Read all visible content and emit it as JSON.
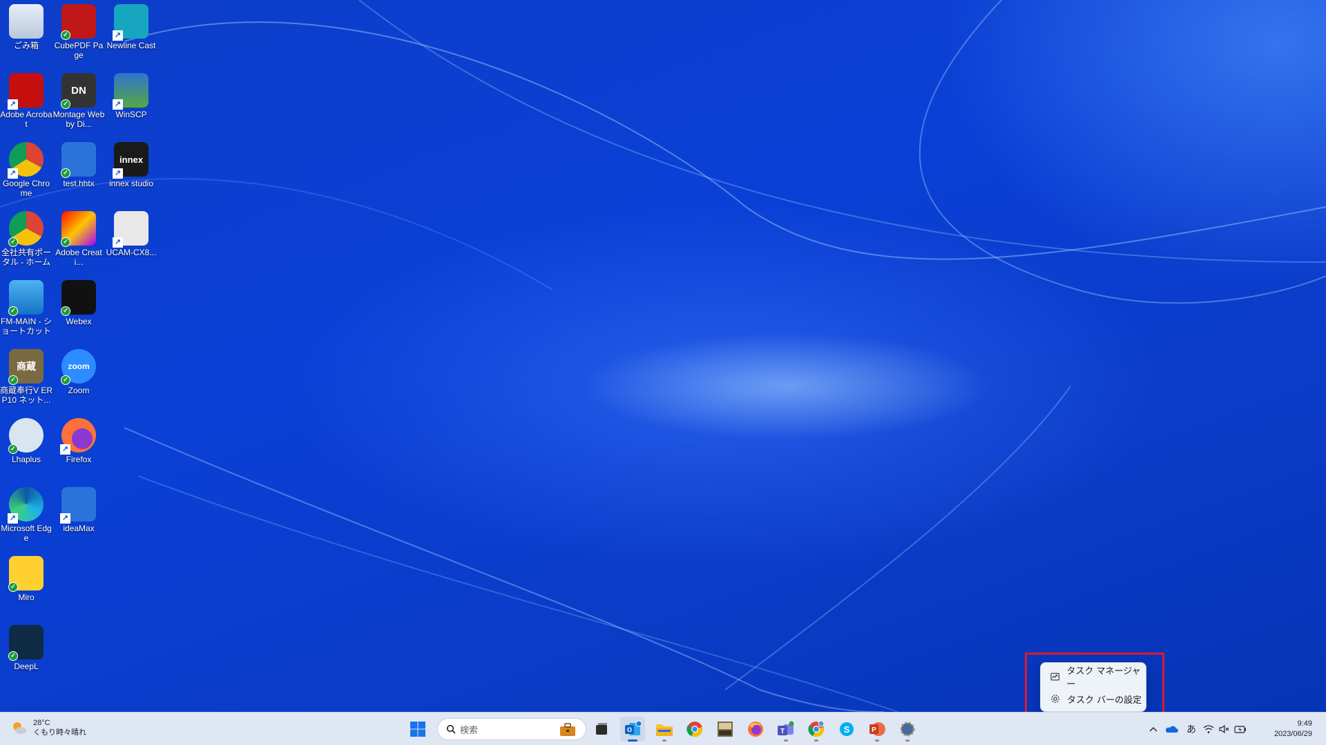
{
  "desktop": {
    "icons": [
      {
        "label": "ごみ箱",
        "icon": "recycle-bin-icon"
      },
      {
        "label": "CubePDF Page",
        "icon": "cubepdf-icon"
      },
      {
        "label": "Newline Cast",
        "icon": "newline-cast-icon"
      },
      {
        "label": "Adobe Acrobat",
        "icon": "acrobat-icon"
      },
      {
        "label": "Montage Web by Di...",
        "icon": "montage-icon",
        "text": "DN"
      },
      {
        "label": "WinSCP",
        "icon": "winscp-icon"
      },
      {
        "label": "Google Chrome",
        "icon": "chrome-icon"
      },
      {
        "label": "test.hhtx",
        "icon": "ideamax-file-icon"
      },
      {
        "label": "innex studio",
        "icon": "innex-studio-icon",
        "text": "innex"
      },
      {
        "label": "全社共有ポータル - ホーム",
        "icon": "chrome-portal-icon"
      },
      {
        "label": "Adobe Creati...",
        "icon": "creative-cloud-icon"
      },
      {
        "label": "UCAM-CX8...",
        "icon": "camera-icon"
      },
      {
        "label": "FM-MAIN - ショートカット",
        "icon": "monitor-icon"
      },
      {
        "label": "Webex",
        "icon": "webex-icon"
      },
      {
        "label": "商蔵奉行V ERP10 ネット...",
        "icon": "shozo-bugyo-icon",
        "text": "商蔵"
      },
      {
        "label": "Zoom",
        "icon": "zoom-icon",
        "text": "zoom"
      },
      {
        "label": "Lhaplus",
        "icon": "lhaplus-icon"
      },
      {
        "label": "Firefox",
        "icon": "firefox-icon"
      },
      {
        "label": "Microsoft Edge",
        "icon": "edge-icon"
      },
      {
        "label": "ideaMax",
        "icon": "ideamax-icon"
      },
      {
        "label": "Miro",
        "icon": "miro-icon"
      },
      {
        "label": "DeepL",
        "icon": "deepl-icon"
      }
    ]
  },
  "taskbar": {
    "weather": {
      "temp": "28°C",
      "desc": "くもり時々晴れ"
    },
    "search_placeholder": "検索",
    "apps": [
      "start-icon",
      "work-icon",
      "task-view-icon",
      "outlook-icon",
      "file-explorer-icon",
      "chrome-icon",
      "shozo-icon",
      "firefox-icon",
      "teams-icon",
      "chrome-profile-icon",
      "skype-icon",
      "powerpoint-icon",
      "settings-icon"
    ],
    "tray": {
      "ime": "あ",
      "time": "9:49",
      "date": "2023/06/29"
    }
  },
  "context_menu": {
    "items": [
      {
        "label": "タスク マネージャー",
        "icon": "task-manager-icon"
      },
      {
        "label": "タスク バーの設定",
        "icon": "gear-icon"
      }
    ]
  },
  "colors": {
    "wallpaper": "#0a40d6",
    "highlight": "#e0182d",
    "taskbar": "#dfe7f5"
  }
}
